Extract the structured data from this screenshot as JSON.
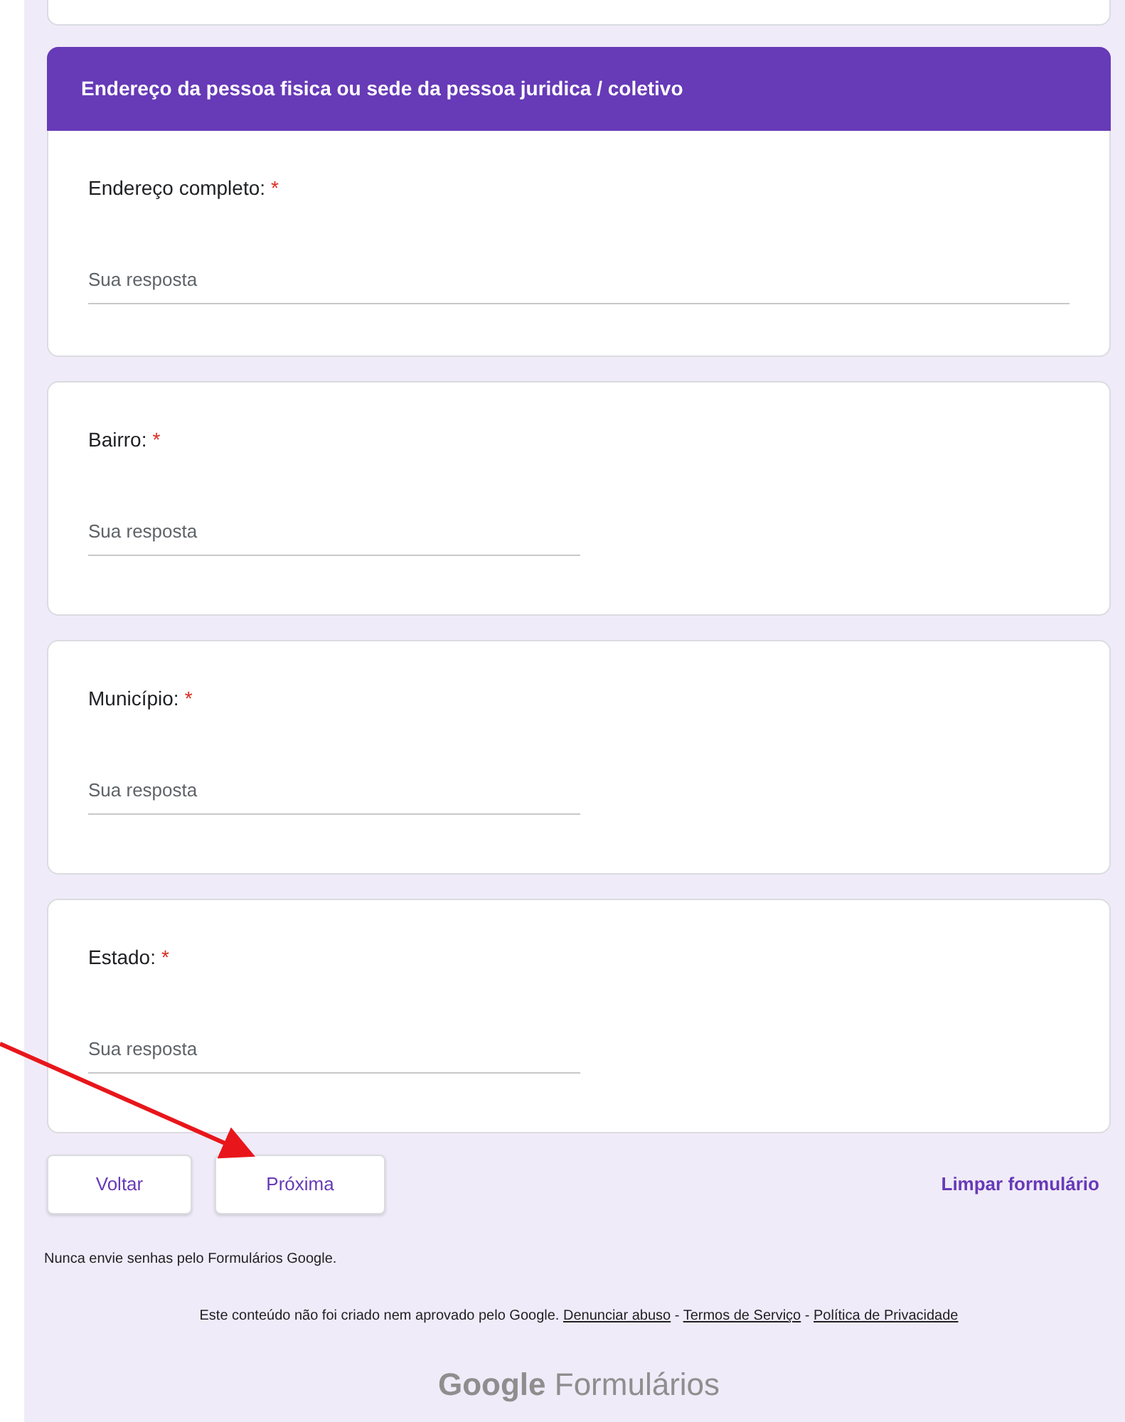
{
  "section": {
    "title": "Endereço da pessoa fisica ou sede da pessoa juridica / coletivo"
  },
  "questions": [
    {
      "label": "Endereço completo:",
      "required_mark": "*",
      "placeholder": "Sua resposta",
      "kind": "wide"
    },
    {
      "label": "Bairro:",
      "required_mark": "*",
      "placeholder": "Sua resposta",
      "kind": "narrow"
    },
    {
      "label": "Município:",
      "required_mark": "*",
      "placeholder": "Sua resposta",
      "kind": "narrow"
    },
    {
      "label": "Estado:",
      "required_mark": "*",
      "placeholder": "Sua resposta",
      "kind": "narrow"
    }
  ],
  "nav": {
    "back": "Voltar",
    "next": "Próxima",
    "clear": "Limpar formulário"
  },
  "footer": {
    "warning": "Nunca envie senhas pelo Formulários Google.",
    "disclaimer": "Este conteúdo não foi criado nem aprovado pelo Google.",
    "links": [
      {
        "label": "Denunciar abuso"
      },
      {
        "label": "Termos de Serviço"
      },
      {
        "label": "Política de Privacidade"
      }
    ],
    "separator": "-"
  },
  "logo": {
    "brand": "Google",
    "product": "Formulários"
  }
}
